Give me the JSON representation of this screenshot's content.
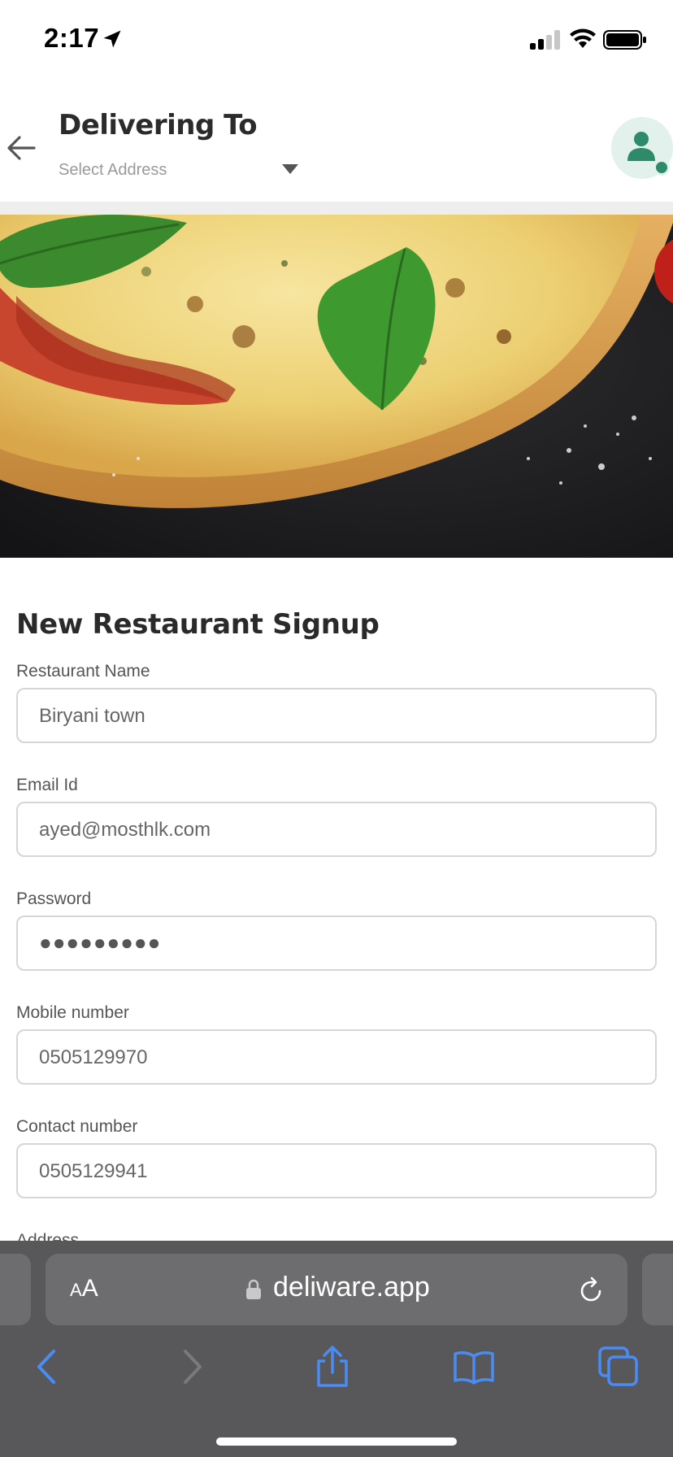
{
  "status_bar": {
    "time": "2:17"
  },
  "header": {
    "title": "Delivering To",
    "address_placeholder": "Select Address"
  },
  "form": {
    "title": "New Restaurant Signup",
    "fields": [
      {
        "label": "Restaurant Name",
        "value": "Biryani town"
      },
      {
        "label": "Email Id",
        "value": "ayed@mosthlk.com"
      },
      {
        "label": "Password",
        "value": "●●●●●●●●●"
      },
      {
        "label": "Mobile number",
        "value": "0505129970"
      },
      {
        "label": "Contact number",
        "value": "0505129941"
      },
      {
        "label": "Address",
        "value": ""
      }
    ]
  },
  "browser": {
    "text_size_label_small": "A",
    "text_size_label_large": "A",
    "url": "deliware.app"
  },
  "colors": {
    "accent_green": "#2e8b6a",
    "avatar_bg": "#e2f1ec",
    "safari_blue": "#4a8cf5",
    "safari_bg": "#58585a"
  }
}
